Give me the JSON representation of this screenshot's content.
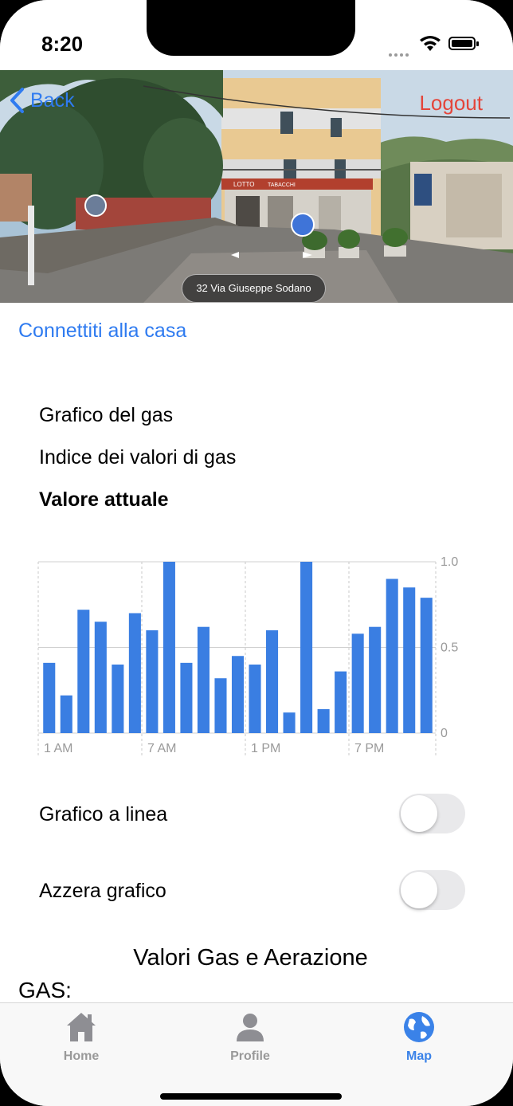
{
  "status": {
    "time": "8:20"
  },
  "nav": {
    "back_label": "Back",
    "logout_label": "Logout"
  },
  "street_view": {
    "address": "32 Via Giuseppe Sodano",
    "sign_lotto": "LOTTO",
    "sign_tabacchi": "TABACCHI"
  },
  "connect_label": "Connettiti alla casa",
  "menu": {
    "items": [
      {
        "label": "Grafico del gas",
        "active": false
      },
      {
        "label": "Indice dei valori di gas",
        "active": false
      },
      {
        "label": "Valore attuale",
        "active": true
      }
    ]
  },
  "chart_data": {
    "type": "bar",
    "color": "#3a7ee2",
    "x_tick_labels": [
      "1 AM",
      "7 AM",
      "1 PM",
      "7 PM"
    ],
    "y_tick_labels": [
      "1.0",
      "0.5",
      "0"
    ],
    "ylim": [
      0,
      1.0
    ],
    "grid": true,
    "values": [
      0.41,
      0.22,
      0.72,
      0.65,
      0.4,
      0.7,
      0.6,
      1.0,
      0.41,
      0.62,
      0.32,
      0.45,
      0.4,
      0.6,
      0.12,
      1.0,
      0.14,
      0.36,
      0.58,
      0.62,
      0.9,
      0.85,
      0.79
    ]
  },
  "toggles": {
    "line_chart": {
      "label": "Grafico a linea",
      "on": false
    },
    "reset_chart": {
      "label": "Azzera grafico",
      "on": false
    }
  },
  "section": {
    "title": "Valori Gas e Aerazione",
    "gas_label": "GAS:"
  },
  "tabbar": {
    "tabs": [
      {
        "label": "Home",
        "icon": "house-icon",
        "active": false
      },
      {
        "label": "Profile",
        "icon": "person-icon",
        "active": false
      },
      {
        "label": "Map",
        "icon": "globe-icon",
        "active": true
      }
    ]
  },
  "colors": {
    "accent": "#2f7bf0",
    "logout": "#e4453a",
    "bar": "#3a7ee2",
    "tab_active": "#3a82e8",
    "tab_inactive": "#999999"
  }
}
